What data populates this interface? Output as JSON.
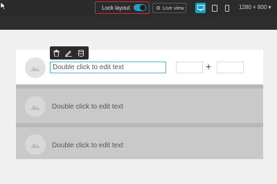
{
  "header": {
    "lock_layout_label": "Lock layout",
    "lock_layout_on": true,
    "live_view_label": "Live view",
    "resolution_label": "1280 × 800 ▾",
    "devices": [
      "desktop-icon",
      "tablet-icon",
      "mobile-icon"
    ],
    "active_device": "desktop"
  },
  "canvas": {
    "rows": [
      {
        "text": "Double click to edit text",
        "editing": true
      },
      {
        "text": "Double click to edit text",
        "editing": false
      },
      {
        "text": "Double click to edit text",
        "editing": false
      }
    ],
    "plus_symbol": "+"
  },
  "toolbar": {
    "buttons": [
      "delete-icon",
      "edit-icon",
      "database-icon"
    ]
  },
  "colors": {
    "accent": "#1aa0c4",
    "highlight_border": "#e0243a",
    "topbar_bg": "#2b2b2b"
  }
}
